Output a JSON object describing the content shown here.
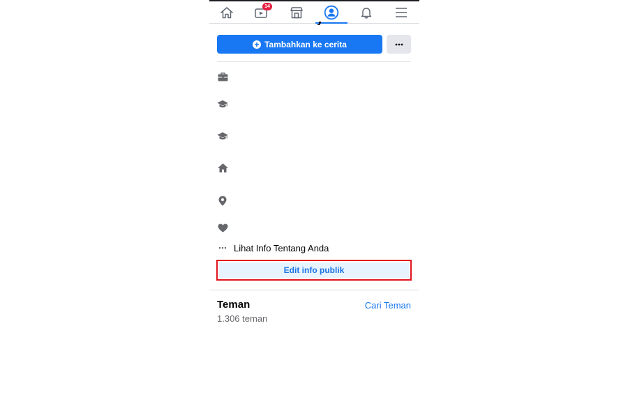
{
  "nav": {
    "watch_badge": "14",
    "items": [
      "home-icon",
      "watch-icon",
      "marketplace-icon",
      "profile-icon",
      "notifications-icon",
      "menu-icon"
    ],
    "active_color": "#1877f2",
    "icon_color": "#606770"
  },
  "actions": {
    "add_story_label": "Tambahkan ke cerita",
    "more_label": "···"
  },
  "about": {
    "see_about_label": "Lihat Info Tentang Anda",
    "edit_public_info_label": "Edit info publik",
    "icons": [
      "briefcase-icon",
      "graduation-cap-icon",
      "graduation-cap-icon",
      "house-icon",
      "location-pin-icon",
      "heart-icon"
    ]
  },
  "friends": {
    "title": "Teman",
    "find_friends_label": "Cari Teman",
    "count_text": "1.306 teman"
  },
  "colors": {
    "primary_blue": "#1877f2",
    "highlight_red": "#e0141e",
    "badge_red": "#e41e3f"
  }
}
